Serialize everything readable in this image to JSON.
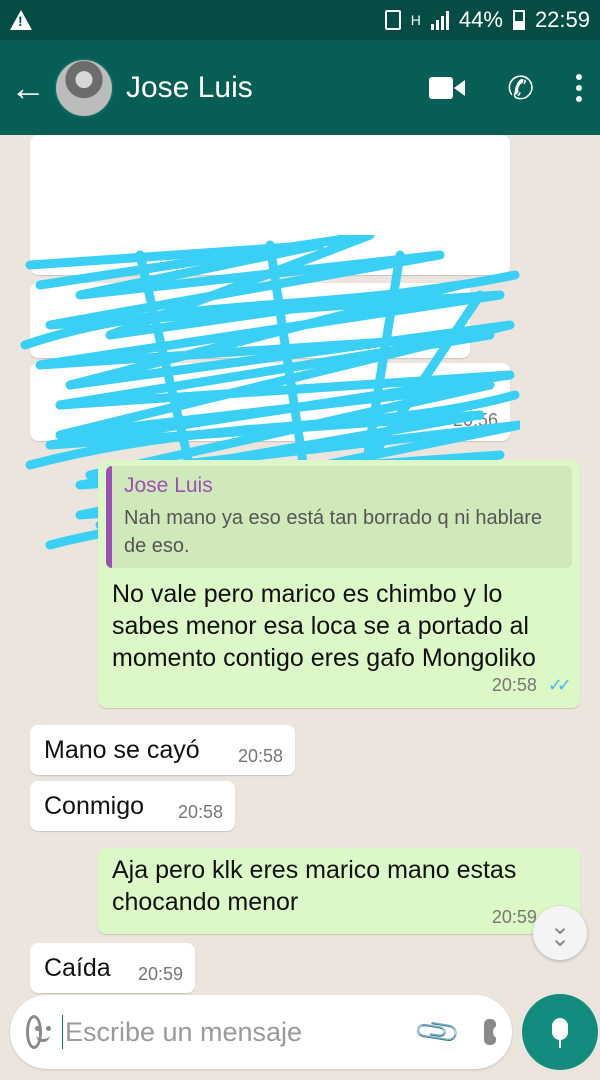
{
  "status_bar": {
    "network_label": "H",
    "battery": "44%",
    "time": "22:59"
  },
  "header": {
    "contact_name": "Jose Luis",
    "back_icon": "back-arrow-icon",
    "video_icon": "video-call-icon",
    "call_icon": "phone-icon",
    "menu_icon": "more-vert-icon"
  },
  "messages": [
    {
      "direction": "out",
      "quote_author": "Jose Luis",
      "quote_text": "Nah mano ya eso está tan borrado q ni hablare de eso.",
      "text": "No vale pero marico es chimbo y lo sabes menor esa loca se a portado al momento contigo eres gafo Mongoliko",
      "time": "20:58"
    },
    {
      "direction": "in",
      "text": "Mano se cayó",
      "time": "20:58"
    },
    {
      "direction": "in",
      "text": "Conmigo",
      "time": "20:58"
    },
    {
      "direction": "out",
      "text": "Aja pero klk eres marico mano estas chocando menor",
      "time": "20:59"
    },
    {
      "direction": "in",
      "text": "Caída",
      "time": "20:59"
    }
  ],
  "obscured_times": [
    "20:56"
  ],
  "composer": {
    "placeholder": "Escribe un mensaje"
  },
  "colors": {
    "status_bar": "#054d44",
    "header": "#075e54",
    "outgoing_bubble": "#dcf8c6",
    "incoming_bubble": "#ffffff",
    "scribble": "#3ad0f5",
    "read_ticks": "#4fb6ec",
    "fab": "#128c7e"
  }
}
